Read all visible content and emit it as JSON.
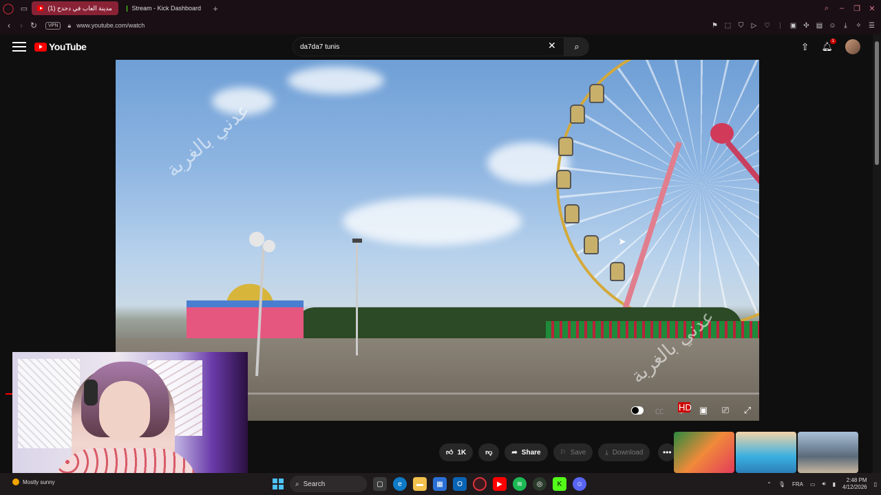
{
  "browser": {
    "tabs": [
      {
        "label": "(1) أكبر مدينة العاب في دحدح",
        "active": true
      },
      {
        "label": "Stream - Kick Dashboard",
        "active": false
      }
    ],
    "vpn_label": "VPN",
    "url": "www.youtube.com/watch"
  },
  "youtube": {
    "logo_text": "YouTube",
    "search_value": "da7da7 tunis",
    "notification_count": "1"
  },
  "video": {
    "watermark_text": "عدني بالغربة",
    "hd_badge": "HD"
  },
  "actions": {
    "like_count": "1K",
    "share_label": "Share",
    "save_label": "Save",
    "download_label": "Download"
  },
  "taskbar": {
    "weather": "Mostly sunny",
    "search_label": "Search",
    "language": "FRA",
    "time": "2:48 PM",
    "date": "4/12/2026"
  },
  "colors": {
    "accent_red": "#ff0000",
    "tab_active": "#8a2236",
    "page_bg": "#0f0f0f"
  }
}
